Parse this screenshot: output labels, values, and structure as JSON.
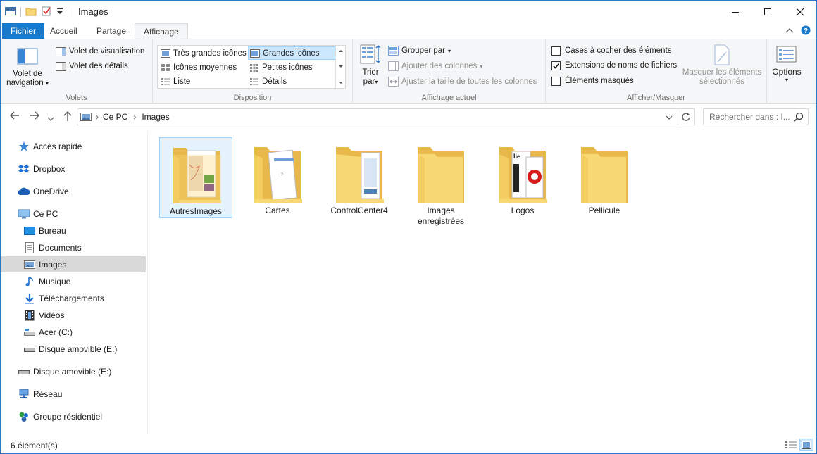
{
  "window": {
    "title": "Images"
  },
  "tabs": {
    "file": "Fichier",
    "home": "Accueil",
    "share": "Partage",
    "view": "Affichage"
  },
  "ribbon": {
    "volets": {
      "nav_pane_line1": "Volet de",
      "nav_pane_line2": "navigation",
      "preview": "Volet de visualisation",
      "details": "Volet des détails",
      "label": "Volets"
    },
    "disposition": {
      "items": [
        "Très grandes icônes",
        "Grandes icônes",
        "Icônes moyennes",
        "Petites icônes",
        "Liste",
        "Détails"
      ],
      "label": "Disposition"
    },
    "affichage_actuel": {
      "sort_line1": "Trier",
      "sort_line2": "par",
      "group_by": "Grouper par",
      "add_columns": "Ajouter des colonnes",
      "fit_columns": "Ajuster la taille de toutes les colonnes",
      "label": "Affichage actuel"
    },
    "afficher_masquer": {
      "checkboxes": "Cases à cocher des éléments",
      "extensions": "Extensions de noms de fichiers",
      "hidden": "Éléments masqués",
      "hide_sel_line1": "Masquer les éléments",
      "hide_sel_line2": "sélectionnés",
      "label": "Afficher/Masquer"
    },
    "options": {
      "label": "Options"
    }
  },
  "address": {
    "segments": [
      "Ce PC",
      "Images"
    ],
    "search_placeholder": "Rechercher dans : I..."
  },
  "nav": [
    {
      "label": "Accès rapide",
      "icon": "star-icon"
    },
    {
      "label": "Dropbox",
      "icon": "dropbox-icon"
    },
    {
      "label": "OneDrive",
      "icon": "cloud-icon"
    },
    {
      "label": "Ce PC",
      "icon": "computer-icon"
    },
    {
      "label": "Bureau",
      "icon": "desktop-icon"
    },
    {
      "label": "Documents",
      "icon": "document-icon"
    },
    {
      "label": "Images",
      "icon": "pictures-icon"
    },
    {
      "label": "Musique",
      "icon": "music-icon"
    },
    {
      "label": "Téléchargements",
      "icon": "download-icon"
    },
    {
      "label": "Vidéos",
      "icon": "video-icon"
    },
    {
      "label": "Acer (C:)",
      "icon": "drive-icon"
    },
    {
      "label": "Disque amovible (E:)",
      "icon": "usb-drive-icon"
    },
    {
      "label": "Disque amovible (E:)",
      "icon": "usb-drive-icon"
    },
    {
      "label": "Réseau",
      "icon": "network-icon"
    },
    {
      "label": "Groupe résidentiel",
      "icon": "homegroup-icon"
    }
  ],
  "folders": [
    {
      "line1": "AutresImages",
      "line2": ""
    },
    {
      "line1": "Cartes",
      "line2": ""
    },
    {
      "line1": "ControlCenter4",
      "line2": ""
    },
    {
      "line1": "Images",
      "line2": "enregistrées"
    },
    {
      "line1": "Logos",
      "line2": ""
    },
    {
      "line1": "Pellicule",
      "line2": ""
    }
  ],
  "status": {
    "count": "6 élément(s)"
  },
  "colors": {
    "accent": "#1979ca",
    "folder": "#f8d775",
    "folder_dark": "#e8b84a",
    "selection": "#cce8ff"
  }
}
